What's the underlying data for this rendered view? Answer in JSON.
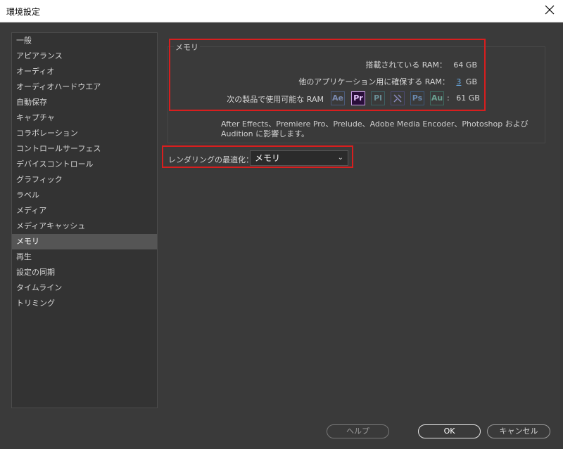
{
  "window": {
    "title": "環境設定"
  },
  "sidebar": {
    "items": [
      {
        "label": "一般"
      },
      {
        "label": "アピアランス"
      },
      {
        "label": "オーディオ"
      },
      {
        "label": "オーディオハードウエア"
      },
      {
        "label": "自動保存"
      },
      {
        "label": "キャプチャ"
      },
      {
        "label": "コラボレーション"
      },
      {
        "label": "コントロールサーフェス"
      },
      {
        "label": "デバイスコントロール"
      },
      {
        "label": "グラフィック"
      },
      {
        "label": "ラベル"
      },
      {
        "label": "メディア"
      },
      {
        "label": "メディアキャッシュ"
      },
      {
        "label": "メモリ"
      },
      {
        "label": "再生"
      },
      {
        "label": "設定の同期"
      },
      {
        "label": "タイムライン"
      },
      {
        "label": "トリミング"
      }
    ],
    "selected": "メモリ"
  },
  "memory": {
    "group_title": "メモリ",
    "installed_label": "搭載されている RAM：",
    "installed_value": "64 GB",
    "reserved_label": "他のアプリケーション用に確保する RAM：",
    "reserved_value": "3",
    "reserved_unit": "GB",
    "available_label": "次の製品で使用可能な RAM",
    "available_value": "61 GB",
    "apps": [
      "Ae",
      "Pr",
      "Pl",
      "",
      "Ps",
      "Au"
    ],
    "description": "After Effects、Premiere Pro、Prelude、Adobe Media Encoder、Photoshop および Audition に影響します。"
  },
  "render": {
    "label": "レンダリングの最適化：",
    "value": "メモリ"
  },
  "buttons": {
    "help": "ヘルプ",
    "ok": "OK",
    "cancel": "キャンセル"
  },
  "colors": {
    "highlight_box": "#d81e1e",
    "panel_bg": "#3a3a3a",
    "selected_bg": "#555555"
  }
}
